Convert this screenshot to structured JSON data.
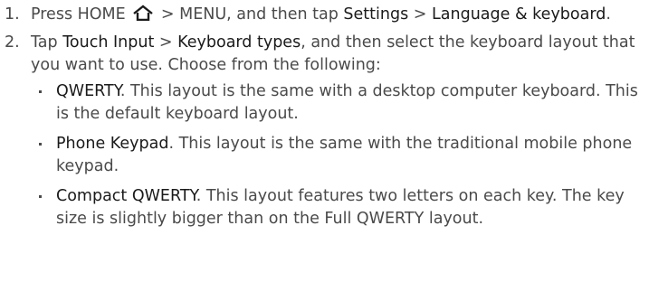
{
  "steps": [
    {
      "number": "1.",
      "part1": "Press HOME",
      "icon": "home-icon",
      "part2": "> MENU, and then tap",
      "kw1": "Settings",
      "sep": ">",
      "kw2": "Language & keyboard",
      "end": "."
    },
    {
      "number": "2.",
      "part1": "Tap",
      "kw1": "Touch Input",
      "sep": ">",
      "kw2": "Keyboard types",
      "part2": ", and then select the keyboard layout that you want to use. Choose from the following:"
    }
  ],
  "options": [
    {
      "name": "QWERTY",
      "description": ". This layout is the same with a desktop computer keyboard. This is the default keyboard layout."
    },
    {
      "name": "Phone Keypad",
      "description": ". This layout is the same with the traditional mobile phone keypad."
    },
    {
      "name": "Compact QWERTY",
      "description": ". This layout features two letters on each key. The key size is slightly bigger than on the Full QWERTY layout."
    }
  ]
}
